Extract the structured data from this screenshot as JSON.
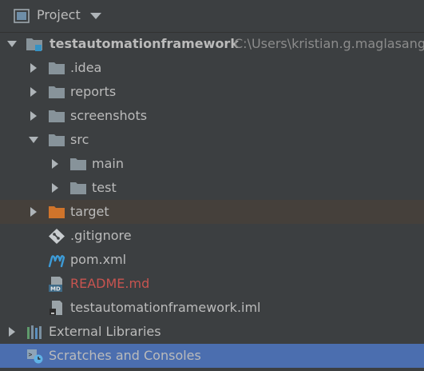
{
  "panel": {
    "title": "Project",
    "title_icon": "project-window-icon",
    "dropdown_icon": "caret-down-icon"
  },
  "tree": {
    "root": {
      "label": "testautomationframework",
      "path": "C:\\Users\\kristian.g.maglasang\\",
      "icon": "module-folder-icon",
      "expanded": true
    },
    "idea": {
      "label": ".idea",
      "icon": "folder-icon",
      "expanded": false
    },
    "reports": {
      "label": "reports",
      "icon": "folder-icon",
      "expanded": false
    },
    "screenshots": {
      "label": "screenshots",
      "icon": "folder-icon",
      "expanded": false
    },
    "src": {
      "label": "src",
      "icon": "folder-icon",
      "expanded": true
    },
    "main": {
      "label": "main",
      "icon": "folder-icon",
      "expanded": false
    },
    "test": {
      "label": "test",
      "icon": "folder-icon",
      "expanded": false
    },
    "target": {
      "label": "target",
      "icon": "excluded-folder-icon",
      "expanded": false
    },
    "gitignore": {
      "label": ".gitignore",
      "icon": "git-file-icon"
    },
    "pom": {
      "label": "pom.xml",
      "icon": "maven-icon"
    },
    "readme": {
      "label": "README.md",
      "icon": "markdown-file-icon"
    },
    "iml": {
      "label": "testautomationframework.iml",
      "icon": "iml-file-icon"
    },
    "external_libraries": {
      "label": "External Libraries",
      "icon": "libraries-icon",
      "expanded": false
    },
    "scratches": {
      "label": "Scratches and Consoles",
      "icon": "scratches-icon",
      "selected": true
    }
  },
  "colors": {
    "background": "#3c3f41",
    "text": "#bbbbbb",
    "path_text": "#8c8c8c",
    "untracked_red": "#c75450",
    "selection": "#4b6eaf",
    "excluded_row": "#45403b",
    "folder": "#87939a",
    "excluded_folder": "#d0742b",
    "maven_blue": "#3d9bd7"
  }
}
